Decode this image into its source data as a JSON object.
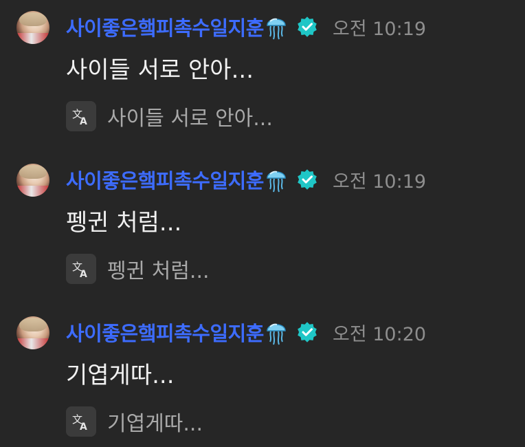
{
  "messages": [
    {
      "username": "사이좋은햌피촉수일지훈",
      "timestamp": "오전 10:19",
      "text": "사이들 서로 안아...",
      "translation": "사이들 서로 안아..."
    },
    {
      "username": "사이좋은햌피촉수일지훈",
      "timestamp": "오전 10:19",
      "text": "펭귄 처럼...",
      "translation": "펭귄 처럼..."
    },
    {
      "username": "사이좋은햌피촉수일지훈",
      "timestamp": "오전 10:20",
      "text": "기엽게따...",
      "translation": "기엽게따..."
    }
  ],
  "icons": {
    "name_emoji": "jellyfish-icon",
    "badge": "verified-icon",
    "translate": "translate-icon"
  },
  "colors": {
    "background": "#262626",
    "username": "#3d6cff",
    "verified_badge": "#1fc6c6",
    "timestamp": "#8e8e8e",
    "message_text": "#f1f1f1",
    "translation_text": "#a9a9a9"
  }
}
